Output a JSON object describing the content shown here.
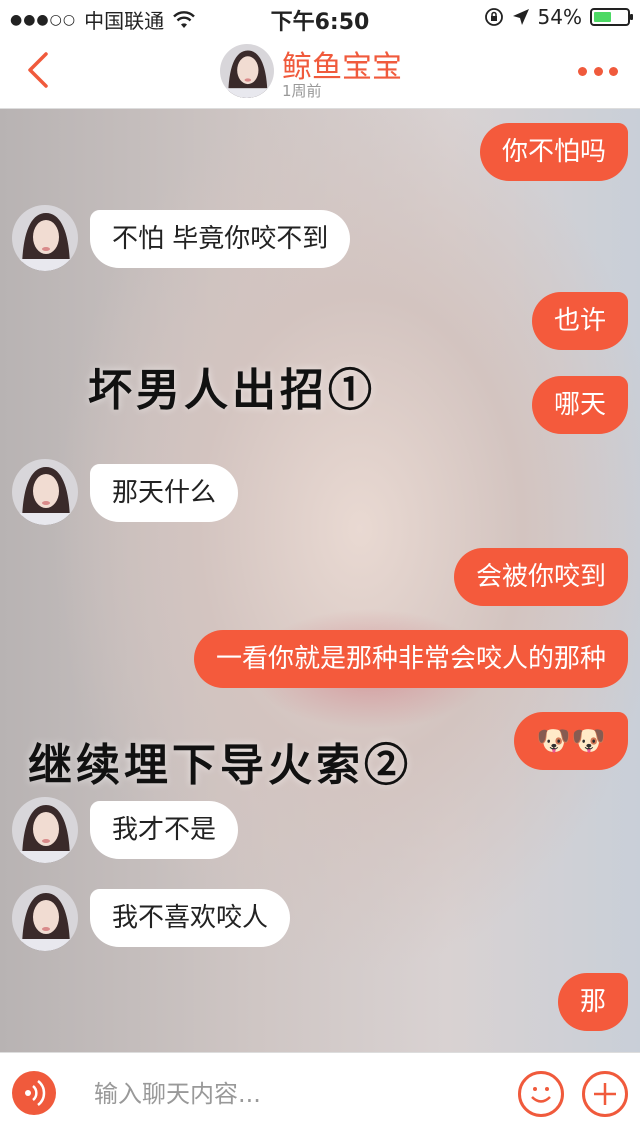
{
  "status_bar": {
    "signal": "●●●○○",
    "carrier": "中国联通",
    "time": "下午6:50",
    "battery": "54%",
    "battery_level": 0.54,
    "icons": [
      "wifi-icon",
      "lock-rotation-icon",
      "location-arrow-icon",
      "battery-icon"
    ]
  },
  "header": {
    "contact_name": "鲸鱼宝宝",
    "last_seen": "1周前",
    "accent": "#f05a3c"
  },
  "overlays": {
    "caption1": "坏男人出招①",
    "caption2": "继续埋下导火索②"
  },
  "messages": [
    {
      "side": "right",
      "text": "你不怕吗"
    },
    {
      "side": "left",
      "text": "不怕  毕竟你咬不到"
    },
    {
      "side": "right",
      "text": "也许"
    },
    {
      "side": "right",
      "text": "哪天"
    },
    {
      "side": "left",
      "text": "那天什么"
    },
    {
      "side": "right",
      "text": "会被你咬到"
    },
    {
      "side": "right",
      "text": "一看你就是那种非常会咬人的那种"
    },
    {
      "side": "right",
      "text": "🐶🐶"
    },
    {
      "side": "left",
      "text": "我才不是"
    },
    {
      "side": "left",
      "text": "我不喜欢咬人"
    },
    {
      "side": "right",
      "text": "那"
    }
  ],
  "input_bar": {
    "placeholder": "输入聊天内容..."
  },
  "colors": {
    "bubble_right": "#f45a3c",
    "bubble_left": "#ffffff"
  }
}
